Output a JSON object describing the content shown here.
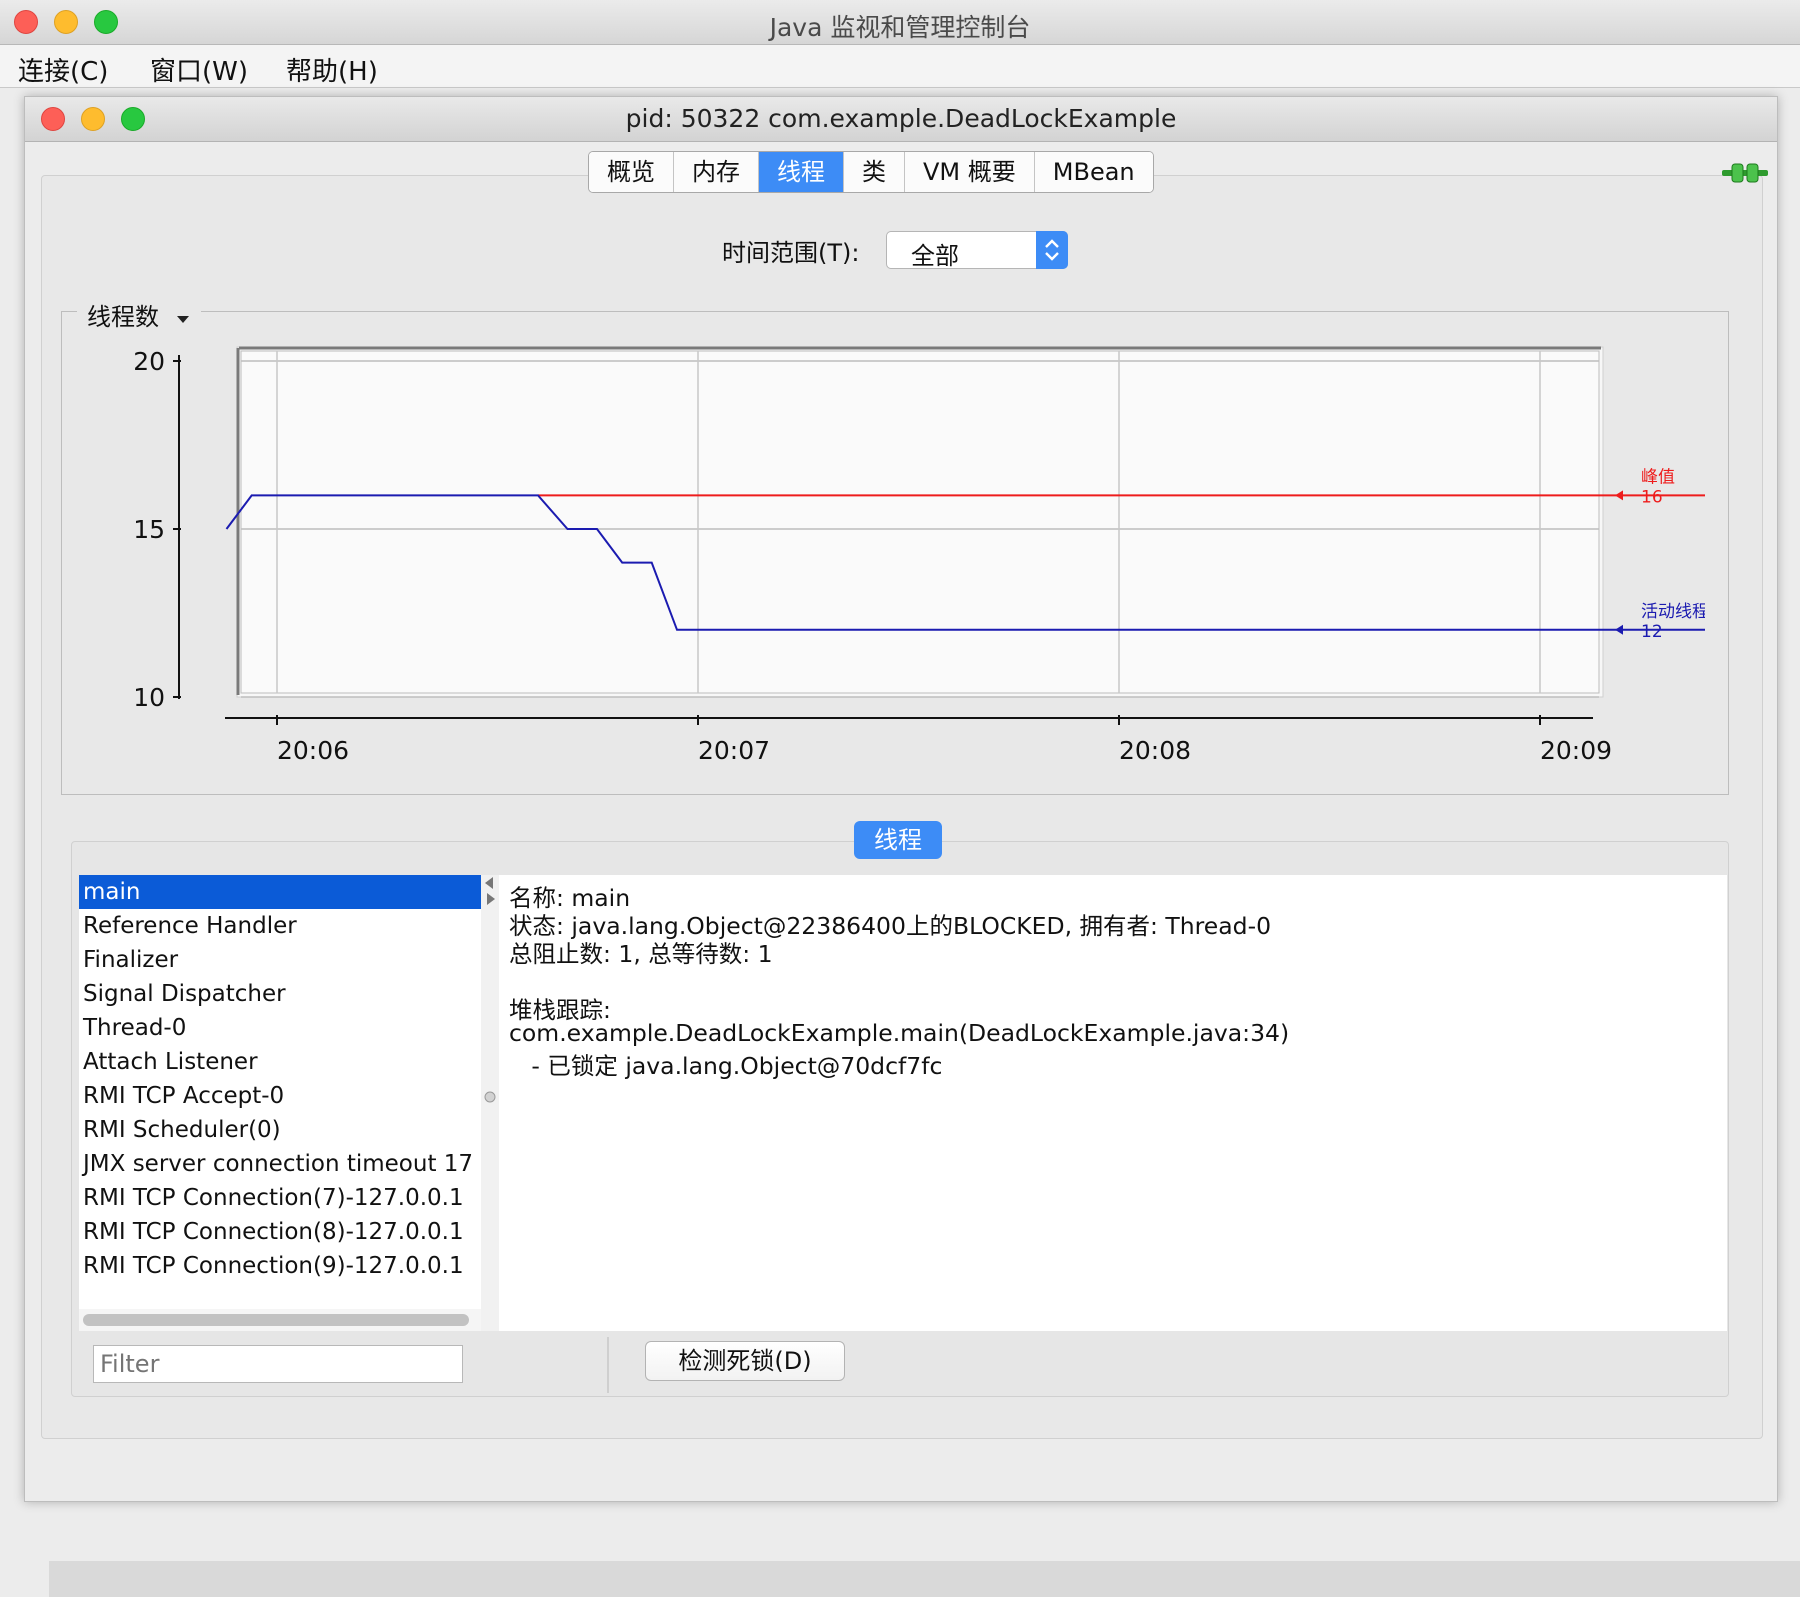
{
  "app": {
    "title": "Java 监视和管理控制台",
    "menu": [
      "连接(C)",
      "窗口(W)",
      "帮助(H)"
    ]
  },
  "window": {
    "title": "pid: 50322 com.example.DeadLockExample",
    "tabs": [
      "概览",
      "内存",
      "线程",
      "类",
      "VM 概要",
      "MBean"
    ],
    "active_tab": "线程"
  },
  "time_range": {
    "label": "时间范围(T):",
    "value": "全部"
  },
  "chart_data": {
    "type": "line",
    "title": "线程数",
    "yticks": [
      20,
      15,
      10
    ],
    "xticks": [
      "20:06",
      "20:07",
      "20:08",
      "20:09"
    ],
    "ylim": [
      10,
      20
    ],
    "grid": true,
    "series": [
      {
        "name": "峰值",
        "value": 16,
        "color": "#ee1c1c",
        "points": [
          [
            0.62,
            16
          ],
          [
            3.8,
            16
          ]
        ]
      },
      {
        "name": "活动线程",
        "value": 12,
        "color": "#1b1bb0",
        "points": [
          [
            -0.12,
            15
          ],
          [
            -0.06,
            16
          ],
          [
            0.62,
            16
          ],
          [
            0.69,
            15
          ],
          [
            0.76,
            15
          ],
          [
            0.82,
            14
          ],
          [
            0.89,
            14
          ],
          [
            0.95,
            12
          ],
          [
            3.8,
            12
          ]
        ]
      }
    ]
  },
  "threads_section": {
    "button_label": "线程",
    "list": [
      "main",
      "Reference Handler",
      "Finalizer",
      "Signal Dispatcher",
      "Thread-0",
      "Attach Listener",
      "RMI TCP Accept-0",
      "RMI Scheduler(0)",
      "JMX server connection timeout 17",
      "RMI TCP Connection(7)-127.0.0.1",
      "RMI TCP Connection(8)-127.0.0.1",
      "RMI TCP Connection(9)-127.0.0.1"
    ],
    "selected": "main",
    "detail": {
      "name_line": "名称: main",
      "state_line": "状态: java.lang.Object@22386400上的BLOCKED, 拥有者: Thread-0",
      "counts_line": "总阻止数: 1, 总等待数: 1",
      "stack_label": "堆栈跟踪:",
      "stack_frame": "com.example.DeadLockExample.main(DeadLockExample.java:34)",
      "lock_line": "   - 已锁定 java.lang.Object@70dcf7fc"
    },
    "filter_placeholder": "Filter",
    "detect_button": "检测死锁(D)"
  }
}
